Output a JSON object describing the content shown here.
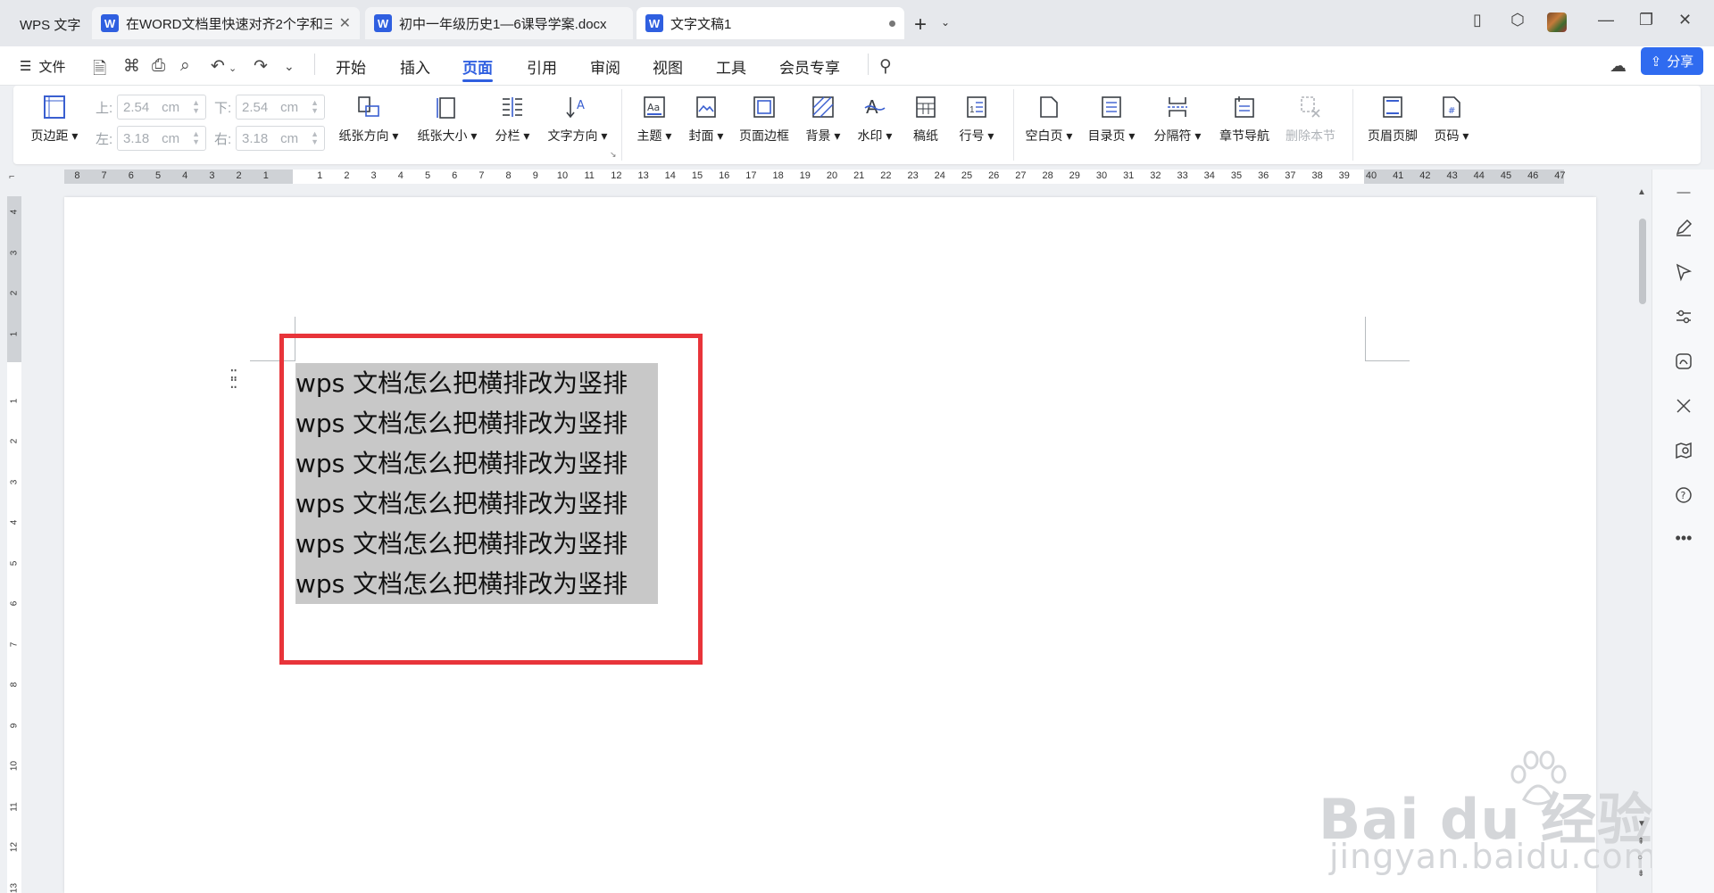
{
  "tabs": {
    "home": "WPS 文字",
    "items": [
      {
        "label": "在WORD文档里快速对齐2个字和三",
        "icon": "W",
        "closable": true
      },
      {
        "label": "初中一年级历史1—6课导学案.docx",
        "icon": "W",
        "closable": false
      },
      {
        "label": "文字文稿1",
        "icon": "W",
        "active": true,
        "unsaved": true
      }
    ]
  },
  "menu": {
    "file": "文件",
    "items": [
      "开始",
      "插入",
      "页面",
      "引用",
      "审阅",
      "视图",
      "工具",
      "会员专享"
    ],
    "active": "页面",
    "share": "分享"
  },
  "ribbon": {
    "margin": {
      "label": "页边距",
      "top_label": "上:",
      "top_value": "2.54",
      "bottom_label": "下:",
      "bottom_value": "2.54",
      "left_label": "左:",
      "left_value": "3.18",
      "right_label": "右:",
      "right_value": "3.18",
      "unit": "cm"
    },
    "buttons": {
      "orientation": "纸张方向",
      "size": "纸张大小",
      "columns": "分栏",
      "text_direction": "文字方向",
      "theme": "主题",
      "cover": "封面",
      "page_border": "页面边框",
      "background": "背景",
      "watermark": "水印",
      "draft": "稿纸",
      "line_number": "行号",
      "blank_page": "空白页",
      "toc_page": "目录页",
      "separator": "分隔符",
      "section_nav": "章节导航",
      "delete_section": "删除本节",
      "header_footer": "页眉页脚",
      "page_number": "页码"
    }
  },
  "ruler": {
    "left_numbers": [
      "8",
      "7",
      "6",
      "5",
      "4",
      "3",
      "2",
      "1"
    ],
    "right_numbers": [
      "1",
      "2",
      "3",
      "4",
      "5",
      "6",
      "7",
      "8",
      "9",
      "10",
      "11",
      "12",
      "13",
      "14",
      "15",
      "16",
      "17",
      "18",
      "19",
      "20",
      "21",
      "22",
      "23",
      "24",
      "25",
      "26",
      "27",
      "28",
      "29",
      "30",
      "31",
      "32",
      "33",
      "34",
      "35",
      "36",
      "37",
      "38",
      "39",
      "40",
      "41",
      "42",
      "43",
      "44",
      "45",
      "46",
      "47"
    ],
    "v_top_numbers": [
      "4",
      "3",
      "2",
      "1"
    ],
    "v_numbers": [
      "1",
      "2",
      "3",
      "4",
      "5",
      "6",
      "7",
      "8",
      "9",
      "10",
      "11",
      "12",
      "13"
    ]
  },
  "document": {
    "lines": [
      "wps 文档怎么把横排改为竖排",
      "wps 文档怎么把横排改为竖排",
      "wps 文档怎么把横排改为竖排",
      "wps 文档怎么把横排改为竖排",
      "wps 文档怎么把横排改为竖排",
      "wps 文档怎么把横排改为竖排"
    ]
  },
  "watermark": {
    "main": "Bai du 经验",
    "sub": "jingyan.baidu.com"
  },
  "colors": {
    "accent": "#2f5fe0",
    "highlight_box": "#e8343a",
    "selection": "#c8c8c8"
  }
}
